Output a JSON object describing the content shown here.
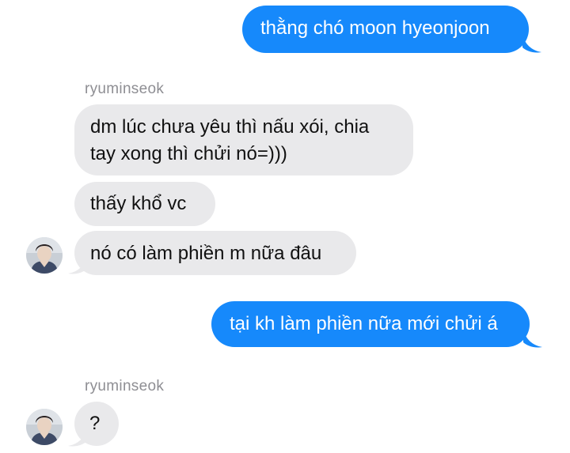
{
  "colors": {
    "outgoing_bubble": "#1689fb",
    "incoming_bubble": "#e9e9eb",
    "sender_label": "#8e8e93"
  },
  "messages": {
    "m1": "thằng chó moon hyeonjoon",
    "sender1": "ryuminseok",
    "m2_line1": "dm lúc chưa yêu thì nấu xói, chia",
    "m2_line2": "tay xong thì chửi nó=)))",
    "m3": "thấy khổ vc",
    "m4": "nó có làm phiền m nữa đâu",
    "m5": "tại kh làm phiền nữa mới chửi á",
    "sender2": "ryuminseok",
    "m6": "?"
  },
  "avatar_icon": "user-photo"
}
